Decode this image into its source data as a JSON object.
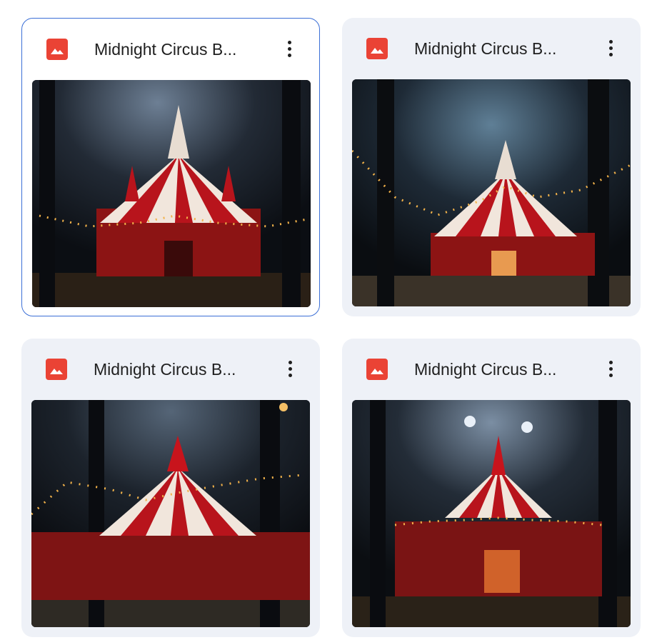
{
  "files": [
    {
      "name": "Midnight Circus B...",
      "icon": "image-icon",
      "selected": true
    },
    {
      "name": "Midnight Circus B...",
      "icon": "image-icon",
      "selected": false
    },
    {
      "name": "Midnight Circus B...",
      "icon": "image-icon",
      "selected": false
    },
    {
      "name": "Midnight Circus B...",
      "icon": "image-icon",
      "selected": false
    }
  ],
  "colors": {
    "accent": "#ea4335",
    "selected_border": "#3b6fd6",
    "card_bg": "#eef1f7"
  }
}
